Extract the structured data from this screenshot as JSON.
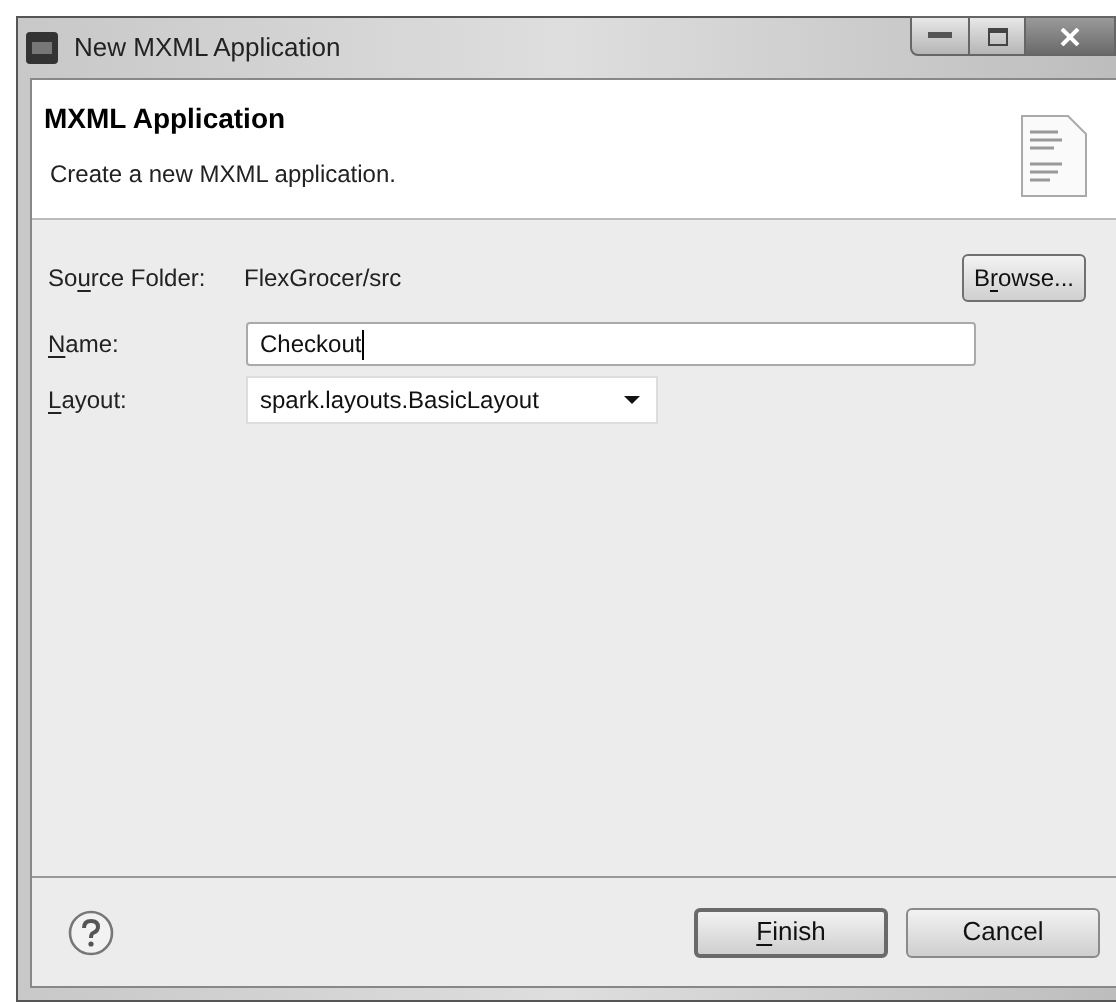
{
  "window": {
    "title": "New MXML Application"
  },
  "header": {
    "title": "MXML Application",
    "description": "Create a new MXML application."
  },
  "source_folder": {
    "label": [
      {
        "text": "So",
        "underlined": false
      },
      {
        "text": "u",
        "underlined": true
      },
      {
        "text": "rce Folder:",
        "underlined": false
      }
    ],
    "value": "FlexGrocer/src",
    "button": {
      "label": [
        {
          "text": "B",
          "underlined": false
        },
        {
          "text": "r",
          "underlined": true
        },
        {
          "text": "owse...",
          "underlined": false
        }
      ]
    }
  },
  "name": {
    "label": [
      {
        "text": "N",
        "underlined": true
      },
      {
        "text": "ame:",
        "underlined": false
      }
    ],
    "value": "Checkout",
    "focused": true
  },
  "layout": {
    "label": [
      {
        "text": "L",
        "underlined": true
      },
      {
        "text": "ayout:",
        "underlined": false
      }
    ],
    "value": "spark.layouts.BasicLayout"
  },
  "buttons": [
    {
      "label": [
        {
          "text": "F",
          "underlined": true
        },
        {
          "text": "inish",
          "underlined": false
        }
      ],
      "default": true
    },
    {
      "label": [
        {
          "text": "Cancel",
          "underlined": false
        }
      ],
      "default": false
    }
  ]
}
